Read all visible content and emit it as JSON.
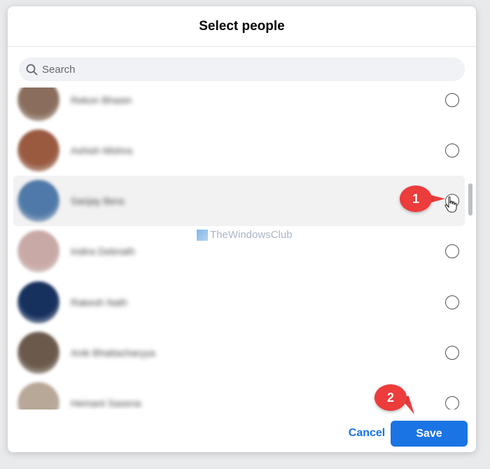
{
  "dialog": {
    "title": "Select people"
  },
  "search": {
    "placeholder": "Search",
    "value": ""
  },
  "people": [
    {
      "name": "Rekon Bhasin",
      "avatar_color": "#8a6d5c",
      "selected": false
    },
    {
      "name": "Ashish Mishra",
      "avatar_color": "#9a5a40",
      "selected": false
    },
    {
      "name": "Sanjay Bera",
      "avatar_color": "#4f79a8",
      "selected": false,
      "hovered": true
    },
    {
      "name": "Indira Debnath",
      "avatar_color": "#c9a9a6",
      "selected": false
    },
    {
      "name": "Rakesh Nath",
      "avatar_color": "#17315e",
      "selected": false
    },
    {
      "name": "Anik Bhattacharyya",
      "avatar_color": "#6b5a4c",
      "selected": false
    },
    {
      "name": "Hemant Saxena",
      "avatar_color": "#b7a897",
      "selected": false
    }
  ],
  "footer": {
    "cancel_label": "Cancel",
    "save_label": "Save"
  },
  "annotations": {
    "step1": "1",
    "step2": "2"
  },
  "watermark": "TheWindowsClub",
  "colors": {
    "accent": "#1b74e4",
    "callout": "#ec3c3c",
    "hover_row": "#f2f2f2"
  }
}
